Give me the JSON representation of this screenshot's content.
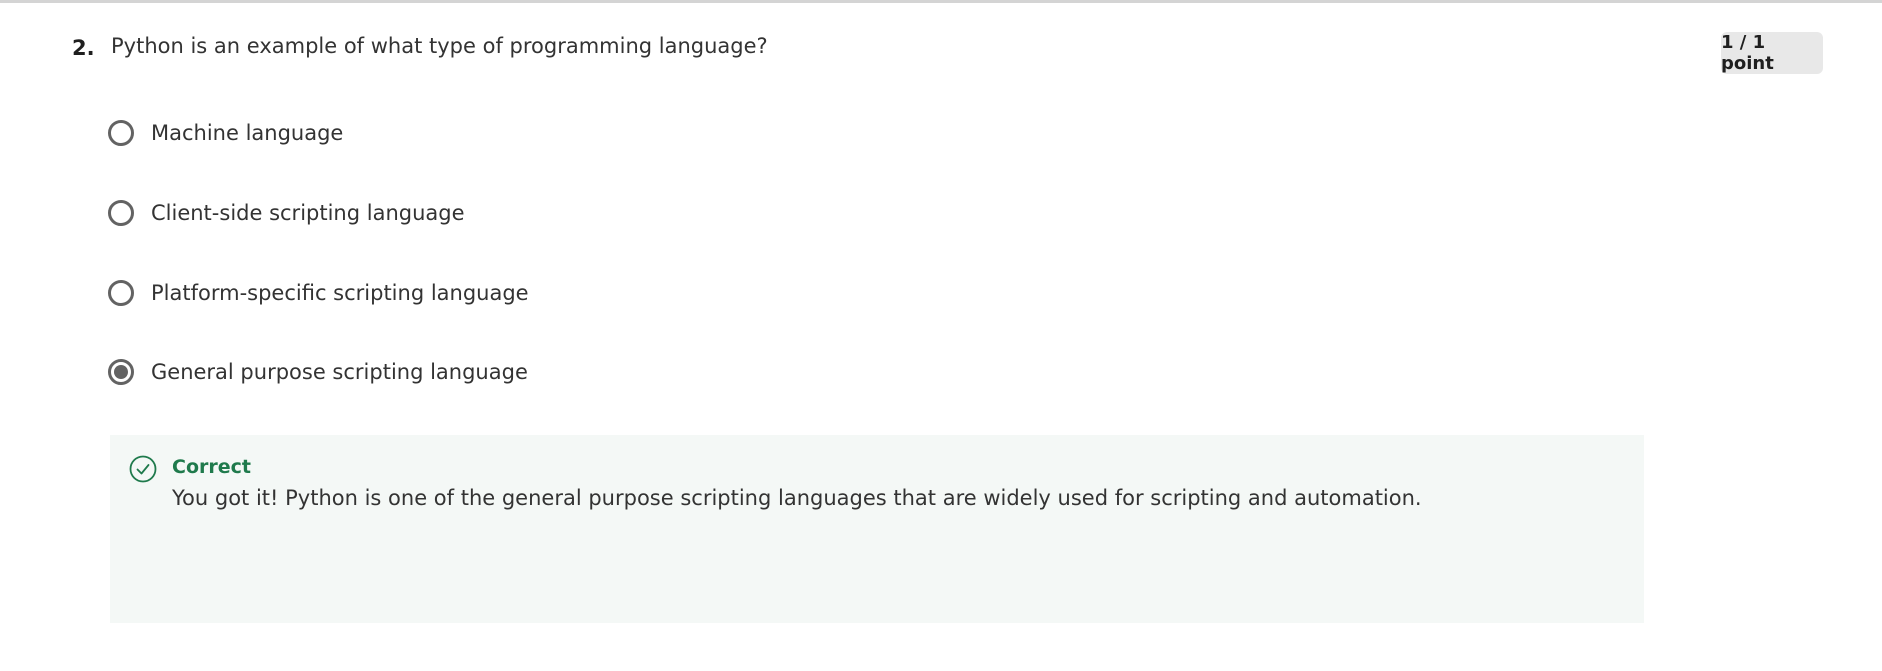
{
  "question": {
    "number": "2.",
    "text": "Python is an example of what type of programming language?",
    "points": "1 / 1 point"
  },
  "options": [
    {
      "label": "Machine language",
      "selected": false
    },
    {
      "label": "Client-side scripting language",
      "selected": false
    },
    {
      "label": "Platform-specific scripting language",
      "selected": false
    },
    {
      "label": "General purpose scripting language",
      "selected": true
    }
  ],
  "feedback": {
    "status": "Correct",
    "message": "You got it! Python is one of the general purpose scripting languages that are widely used for scripting and automation.",
    "icon": "check-circle-icon"
  },
  "colors": {
    "success": "#1f7a4c",
    "feedback_bg": "#f4f8f6",
    "radio": "#636363",
    "badge_bg": "#e8e8e8"
  }
}
